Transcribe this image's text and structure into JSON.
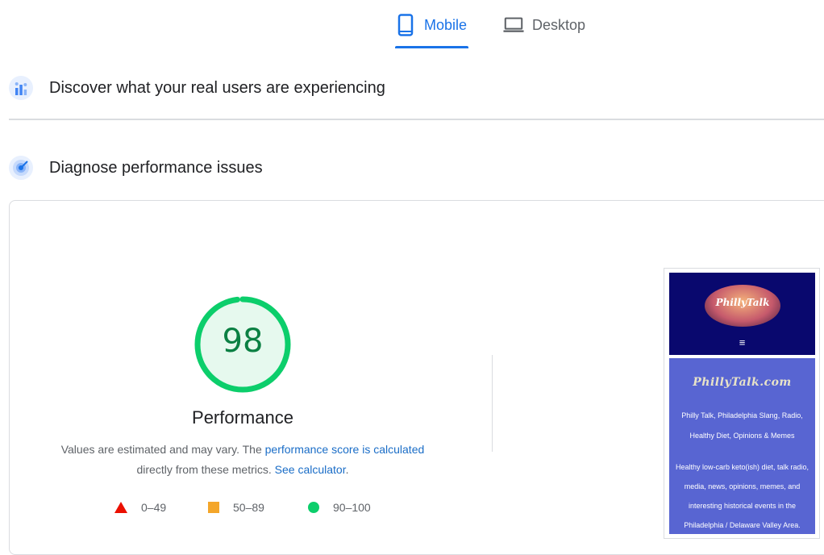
{
  "tabs": {
    "mobile_label": "Mobile",
    "desktop_label": "Desktop",
    "active": "Mobile"
  },
  "sections": {
    "real_users_title": "Discover what your real users are experiencing",
    "diagnose_title": "Diagnose performance issues"
  },
  "performance": {
    "score": "98",
    "score_value": 98,
    "title": "Performance",
    "desc_prefix": "Values are estimated and may vary. The ",
    "desc_link": "performance score is calculated",
    "desc_middle": " directly from these metrics. ",
    "desc_calc_link": "See calculator",
    "desc_suffix": "."
  },
  "legend": {
    "fail": "0–49",
    "average": "50–89",
    "pass": "90–100"
  },
  "thumbnail": {
    "logo_text": "PhillyTalk",
    "menu_glyph": "≡",
    "brand": "PhillyTalk.com",
    "tagline": "Philly Talk, Philadelphia Slang, Radio, Healthy Diet, Opinions & Memes",
    "description": "Healthy low-carb keto(ish) diet, talk radio, media, news, opinions, memes, and interesting historical events in the Philadelphia / Delaware Valley Area."
  },
  "colors": {
    "accent": "#1a73e8",
    "pass": "#0cce6b",
    "pass_text": "#0b8043",
    "average": "#f4a62a",
    "fail": "#eb0f00"
  },
  "icons": {
    "mobile": "smartphone-icon",
    "desktop": "laptop-icon",
    "real_users": "crux-chart-icon",
    "diagnose": "lab-radar-icon"
  }
}
